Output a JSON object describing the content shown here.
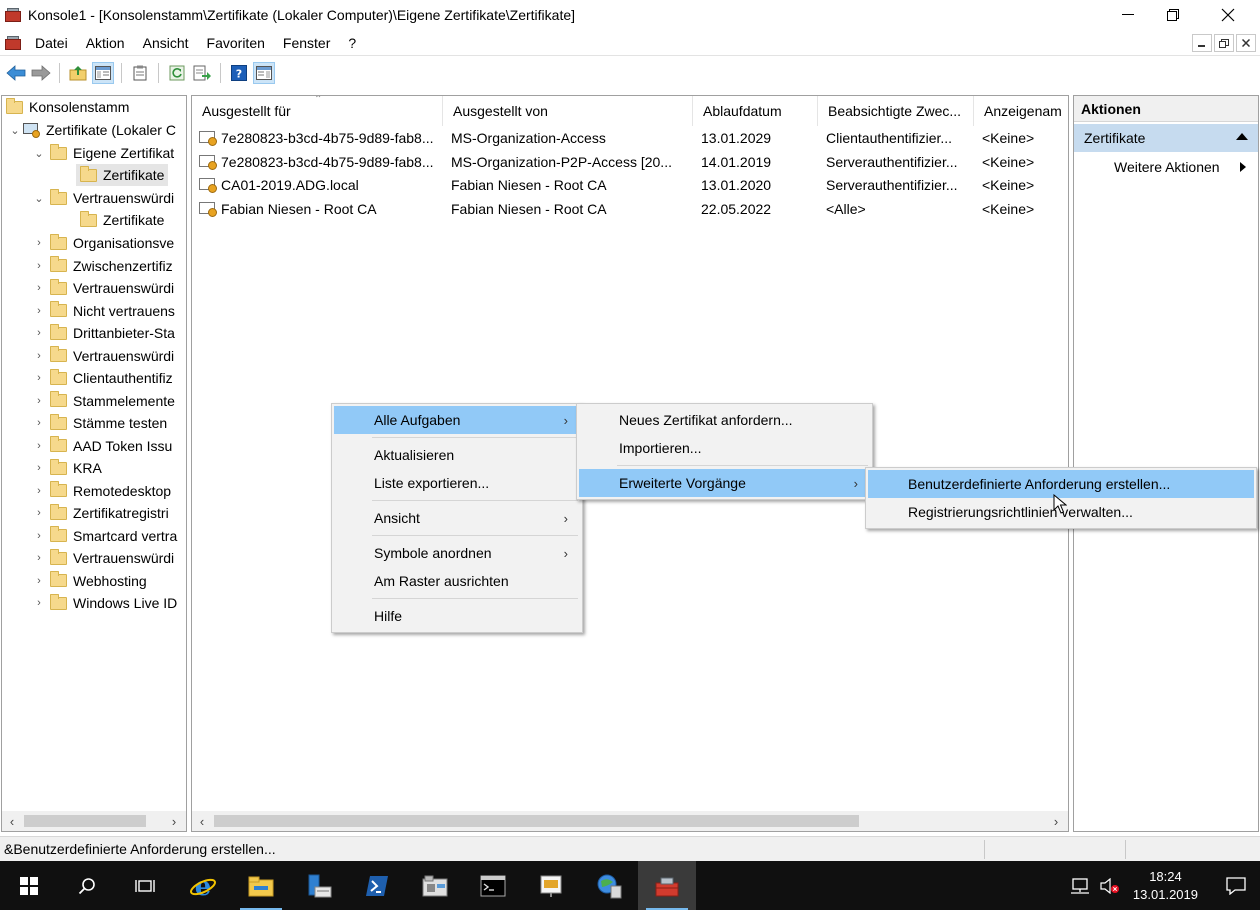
{
  "window": {
    "title": "Konsole1 - [Konsolenstamm\\Zertifikate (Lokaler Computer)\\Eigene Zertifikate\\Zertifikate]"
  },
  "menu": [
    "Datei",
    "Aktion",
    "Ansicht",
    "Favoriten",
    "Fenster",
    "?"
  ],
  "tree": {
    "root": "Konsolenstamm",
    "computer": "Zertifikate (Lokaler C",
    "eigene": "Eigene Zertifikat",
    "eigene_child": "Zertifikate",
    "vertrauens": "Vertrauenswürdi",
    "vertrauens_child": "Zertifikate",
    "stores": [
      "Organisationsve",
      "Zwischenzertifiz",
      "Vertrauenswürdi",
      "Nicht vertrauens",
      "Drittanbieter-Sta",
      "Vertrauenswürdi",
      "Clientauthentifiz",
      "Stammelemente",
      "Stämme testen",
      "AAD Token Issu",
      "KRA",
      "Remotedesktop",
      "Zertifikatregistri",
      "Smartcard vertra",
      "Vertrauenswürdi",
      "Webhosting",
      "Windows Live ID"
    ]
  },
  "list": {
    "columns": [
      "Ausgestellt für",
      "Ausgestellt von",
      "Ablaufdatum",
      "Beabsichtigte Zwec...",
      "Anzeigenam"
    ],
    "rows": [
      [
        "7e280823-b3cd-4b75-9d89-fab8...",
        "MS-Organization-Access",
        "13.01.2029",
        "Clientauthentifizier...",
        "<Keine>"
      ],
      [
        "7e280823-b3cd-4b75-9d89-fab8...",
        "MS-Organization-P2P-Access [20...",
        "14.01.2019",
        "Serverauthentifizier...",
        "<Keine>"
      ],
      [
        "CA01-2019.ADG.local",
        "Fabian Niesen - Root CA",
        "13.01.2020",
        "Serverauthentifizier...",
        "<Keine>"
      ],
      [
        "Fabian Niesen - Root CA",
        "Fabian Niesen - Root CA",
        "22.05.2022",
        "<Alle>",
        "<Keine>"
      ]
    ]
  },
  "actions": {
    "header": "Aktionen",
    "section": "Zertifikate",
    "item": "Weitere Aktionen"
  },
  "context_menu": {
    "all_tasks": "Alle Aufgaben",
    "refresh": "Aktualisieren",
    "export": "Liste exportieren...",
    "view": "Ansicht",
    "arrange": "Symbole anordnen",
    "grid": "Am Raster ausrichten",
    "help": "Hilfe"
  },
  "submenu_tasks": {
    "request": "Neues Zertifikat anfordern...",
    "import": "Importieren...",
    "advanced": "Erweiterte Vorgänge"
  },
  "submenu_advanced": {
    "custom": "Benutzerdefinierte Anforderung erstellen...",
    "policies": "Registrierungsrichtlinien verwalten..."
  },
  "status": "&Benutzerdefinierte Anforderung erstellen...",
  "taskbar": {
    "time": "18:24",
    "date": "13.01.2019"
  }
}
